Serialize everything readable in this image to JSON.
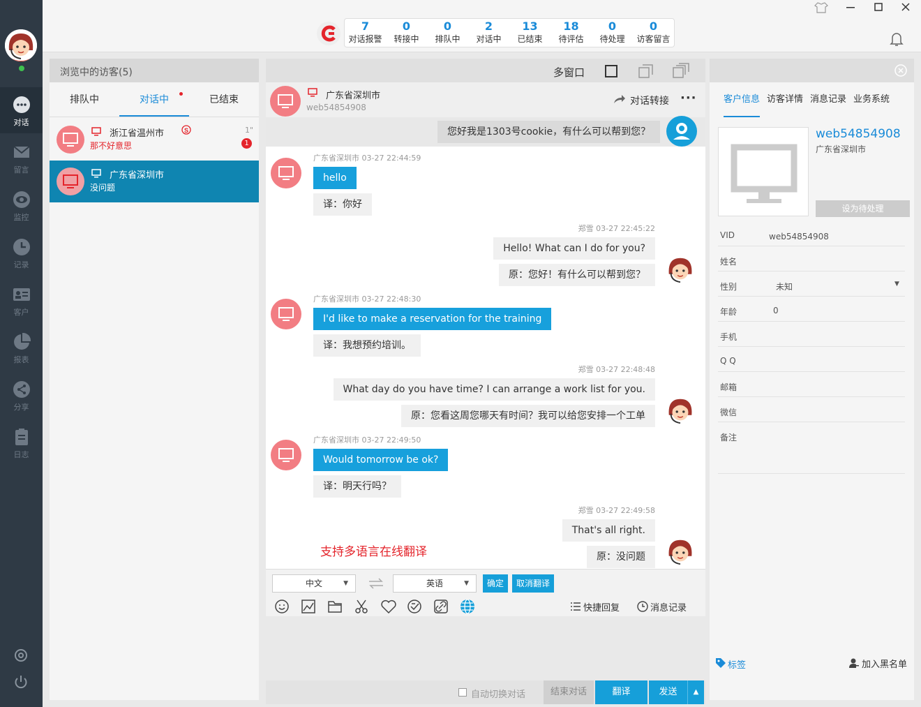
{
  "sidebar": {
    "nav": [
      {
        "label": "对话",
        "icon": "chat-icon",
        "active": true
      },
      {
        "label": "留言",
        "icon": "mail-icon"
      },
      {
        "label": "监控",
        "icon": "eye-icon"
      },
      {
        "label": "记录",
        "icon": "clock-icon"
      },
      {
        "label": "客户",
        "icon": "contact-card-icon"
      },
      {
        "label": "报表",
        "icon": "pie-chart-icon"
      },
      {
        "label": "分享",
        "icon": "share-icon"
      },
      {
        "label": "日志",
        "icon": "clipboard-icon"
      }
    ]
  },
  "stats": [
    {
      "n": "7",
      "label": "对话报警"
    },
    {
      "n": "0",
      "label": "转接中"
    },
    {
      "n": "0",
      "label": "排队中"
    },
    {
      "n": "2",
      "label": "对话中"
    },
    {
      "n": "13",
      "label": "已结束"
    },
    {
      "n": "18",
      "label": "待评估"
    },
    {
      "n": "0",
      "label": "待处理"
    },
    {
      "n": "0",
      "label": "访客留言"
    }
  ],
  "left": {
    "header": "浏览中的访客(5)",
    "tabs": [
      "排队中",
      "对话中",
      "已结束"
    ],
    "visitors": [
      {
        "location": "浙江省温州市",
        "last": "那不好意思",
        "time": "1\"",
        "unread": "1"
      },
      {
        "location": "广东省深圳市",
        "last": "没问题"
      }
    ]
  },
  "mid": {
    "multi_window": "多窗口",
    "visitor_location": "广东省深圳市",
    "visitor_id": "web54854908",
    "transfer": "对话转接",
    "greeting": "您好我是1303号cookie，有什么可以帮到您？",
    "messages": [
      {
        "side": "visitor",
        "meta": "广东省深圳市 03-27 22:44:59",
        "text": "hello",
        "sub": "译：你好"
      },
      {
        "side": "agent",
        "meta": "郑雪 03-27 22:45:22",
        "text": "Hello! What can I do for you?",
        "sub": "原：您好！有什么可以帮到您？"
      },
      {
        "side": "visitor",
        "meta": "广东省深圳市 03-27 22:48:30",
        "text": "I'd like to make a reservation for the training",
        "sub": "译：我想预约培训。"
      },
      {
        "side": "agent",
        "meta": "郑雪 03-27 22:48:48",
        "text": "What day do you have time? I can arrange a work list for you.",
        "sub": "原：您看这周您哪天有时间？我可以给您安排一个工单"
      },
      {
        "side": "visitor",
        "meta": "广东省深圳市 03-27 22:49:50",
        "text": "Would tomorrow be ok?",
        "sub": "译：明天行吗？"
      },
      {
        "side": "agent",
        "meta": "郑雪 03-27 22:49:58",
        "text": "That's all right.",
        "sub": "原：没问题"
      }
    ],
    "promo": "支持多语言在线翻译",
    "translate": {
      "from": "中文",
      "to": "英语",
      "confirm": "确定",
      "cancel": "取消翻译"
    },
    "quick_reply": "快捷回复",
    "history": "消息记录",
    "auto_switch": "自动切换对话",
    "end": "结束对话",
    "translate_btn": "翻译",
    "send": "发送"
  },
  "right": {
    "tabs": [
      "客户信息",
      "访客详情",
      "消息记录",
      "业务系统"
    ],
    "visitor_name": "web54854908",
    "visitor_loc": "广东省深圳市",
    "pending_btn": "设为待处理",
    "fields": [
      {
        "label": "VID",
        "value": "web54854908"
      },
      {
        "label": "姓名",
        "value": ""
      },
      {
        "label": "性别",
        "value": "未知"
      },
      {
        "label": "年龄",
        "value": "0"
      },
      {
        "label": "手机",
        "value": ""
      },
      {
        "label": "Q Q",
        "value": ""
      },
      {
        "label": "邮箱",
        "value": ""
      },
      {
        "label": "微信",
        "value": ""
      },
      {
        "label": "备注",
        "value": ""
      }
    ],
    "tag": "标签",
    "blacklist": "加入黑名单"
  },
  "colors": {
    "accent": "#1a8bd8",
    "bubble": "#17a0dc",
    "visitor_avatar": "#f27d83",
    "promo": "#e4242b"
  }
}
